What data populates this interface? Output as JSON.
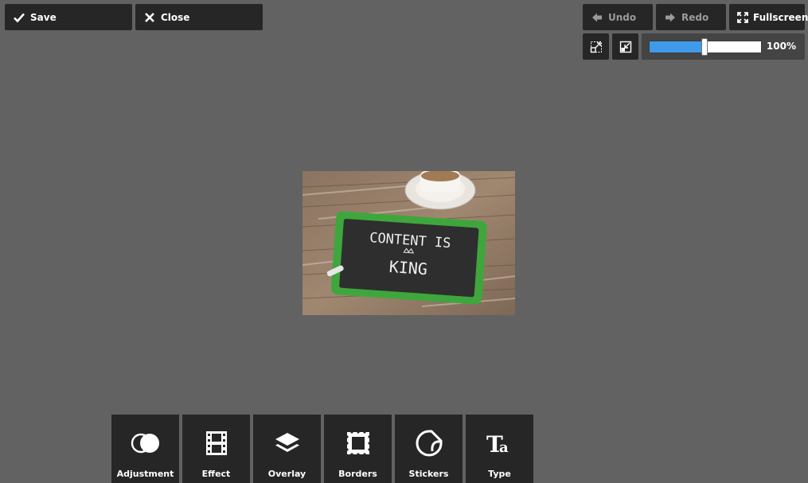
{
  "toolbar": {
    "save_label": "Save",
    "close_label": "Close",
    "undo_label": "Undo",
    "redo_label": "Redo",
    "fullscreen_label": "Fullscreen"
  },
  "zoom": {
    "value_text": "100%",
    "slider_fraction": 0.5
  },
  "canvas": {
    "image_text_line1": "CONTENT IS",
    "image_text_line2": "KING"
  },
  "tools": [
    {
      "label": "Adjustment",
      "icon": "adjustment-icon"
    },
    {
      "label": "Effect",
      "icon": "film-icon"
    },
    {
      "label": "Overlay",
      "icon": "layers-icon"
    },
    {
      "label": "Borders",
      "icon": "border-icon"
    },
    {
      "label": "Stickers",
      "icon": "sticker-icon"
    },
    {
      "label": "Type",
      "icon": "type-icon"
    }
  ],
  "colors": {
    "background": "#626262",
    "button": "#262626",
    "accent": "#3f9bea"
  }
}
